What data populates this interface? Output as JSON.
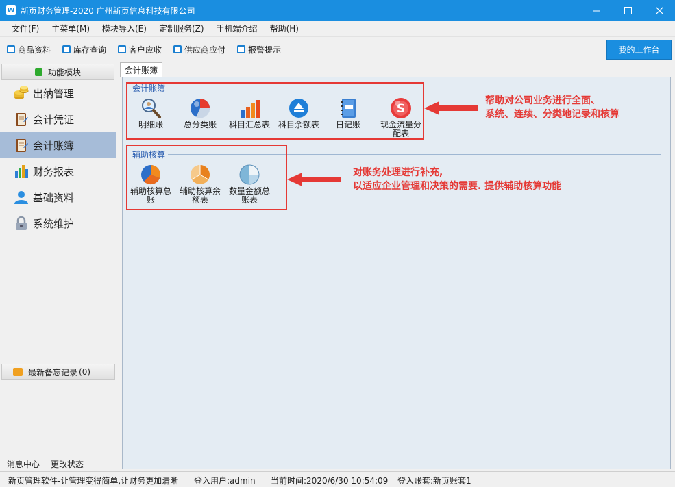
{
  "window": {
    "title": "新页财务管理-2020 广州新页信息科技有限公司",
    "app_icon_text": "W"
  },
  "menu": [
    "文件(F)",
    "主菜单(M)",
    "模块导入(E)",
    "定制服务(Z)",
    "手机端介绍",
    "帮助(H)"
  ],
  "toolbar": {
    "items": [
      "商品资料",
      "库存查询",
      "客户应收",
      "供应商应付",
      "报警提示"
    ],
    "workbench_label": "我的工作台"
  },
  "sidebar": {
    "header": "功能模块",
    "items": [
      {
        "label": "出纳管理",
        "icon": "coins-icon"
      },
      {
        "label": "会计凭证",
        "icon": "ledger-book-icon"
      },
      {
        "label": "会计账簿",
        "icon": "ledger-book-icon",
        "active": true
      },
      {
        "label": "财务报表",
        "icon": "bar-chart-icon"
      },
      {
        "label": "基础资料",
        "icon": "user-icon"
      },
      {
        "label": "系统维护",
        "icon": "lock-icon"
      }
    ],
    "memo_label": "最新备忘记录",
    "memo_count": "(0)",
    "footer": [
      "消息中心",
      "更改状态"
    ]
  },
  "tab": {
    "label": "会计账簿"
  },
  "groups": {
    "ledger": {
      "title": "会计账簿",
      "items": [
        {
          "label": "明细账",
          "icon": "magnifier-person-icon"
        },
        {
          "label": "总分类账",
          "icon": "pie-sphere-icon"
        },
        {
          "label": "科目汇总表",
          "icon": "bar-chart-icon"
        },
        {
          "label": "科目余额表",
          "icon": "eject-circle-icon"
        },
        {
          "label": "日记账",
          "icon": "notebook-icon"
        },
        {
          "label": "现金流量分配表",
          "icon": "dollar-coin-icon"
        }
      ],
      "annotation_lines": [
        "帮助对公司业务进行全面、",
        "系统、连续、分类地记录和核算"
      ]
    },
    "aux": {
      "title": "辅助核算",
      "items": [
        {
          "label": "辅助核算总账",
          "icon": "pie-chart-icon"
        },
        {
          "label": "辅助核算余额表",
          "icon": "pie-chart-icon"
        },
        {
          "label": "数量金额总账表",
          "icon": "pie-chart-icon"
        }
      ],
      "annotation_lines": [
        "对账务处理进行补充,",
        "以适应企业管理和决策的需要. 提供辅助核算功能"
      ]
    }
  },
  "status": {
    "slogan": "新页管理软件-让管理变得简单,让财务更加清晰",
    "user": "登入用户:admin",
    "time": "当前时间:2020/6/30 10:54:09",
    "account": "登入账套:新页账套1"
  },
  "colors": {
    "titlebar": "#1a8ee0",
    "active_sidebar": "#a6bcd8",
    "annotation_red": "#e53935",
    "content_bg": "#e4ecf3"
  }
}
